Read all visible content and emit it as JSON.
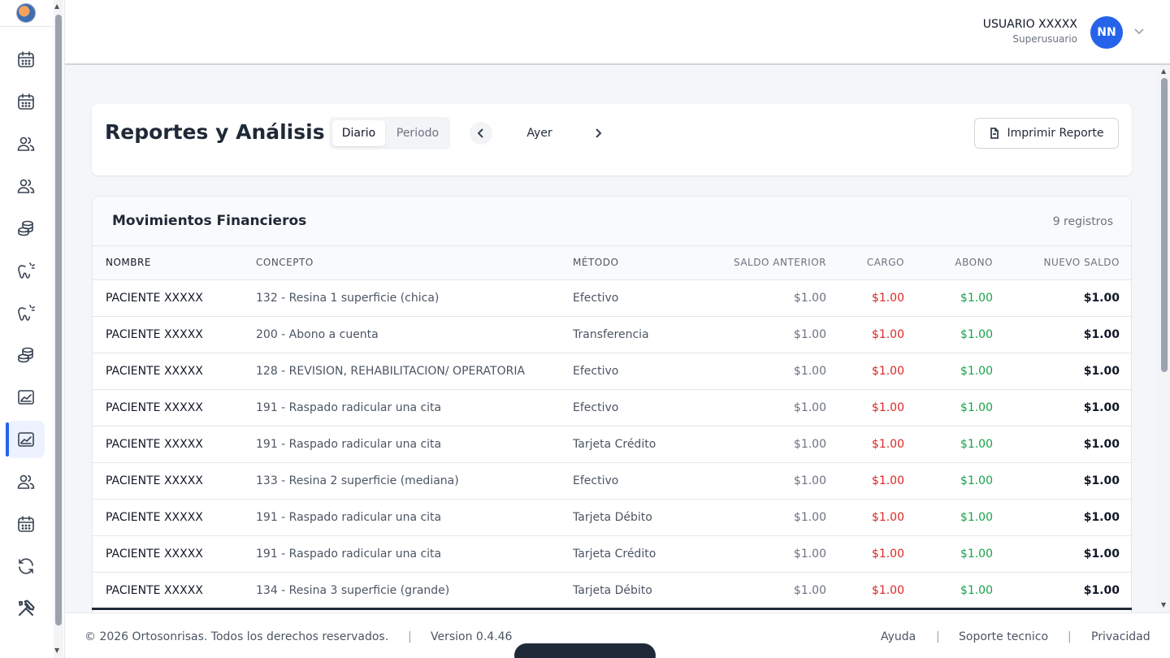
{
  "header": {
    "user_name": "USUARIO XXXXX",
    "user_role": "Superusuario",
    "avatar_initials": "NN"
  },
  "sidebar": {
    "items": [
      {
        "icon": "calendar-icon"
      },
      {
        "icon": "calendar-icon"
      },
      {
        "icon": "users-icon"
      },
      {
        "icon": "users-icon"
      },
      {
        "icon": "coins-icon"
      },
      {
        "icon": "tooth-icon"
      },
      {
        "icon": "tooth-icon"
      },
      {
        "icon": "coins-icon"
      },
      {
        "icon": "chart-icon"
      },
      {
        "icon": "chart-icon",
        "active": true
      },
      {
        "icon": "users-icon"
      },
      {
        "icon": "calendar-icon"
      },
      {
        "icon": "refresh-icon"
      },
      {
        "icon": "tools-icon"
      }
    ]
  },
  "report": {
    "title": "Reportes y Análisis",
    "mode_daily": "Diario",
    "mode_period": "Periodo",
    "date_label": "Ayer",
    "print_label": "Imprimir Reporte"
  },
  "movements": {
    "title": "Movimientos Financieros",
    "count_label": "9 registros",
    "columns": [
      "NOMBRE",
      "CONCEPTO",
      "MÉTODO",
      "SALDO ANTERIOR",
      "CARGO",
      "ABONO",
      "NUEVO SALDO"
    ],
    "rows": [
      {
        "nombre": "PACIENTE XXXXX",
        "concepto": "132 - Resina 1 superficie (chica)",
        "metodo": "Efectivo",
        "saldo": "$1.00",
        "cargo": "$1.00",
        "abono": "$1.00",
        "nuevo": "$1.00"
      },
      {
        "nombre": "PACIENTE XXXXX",
        "concepto": "200 - Abono a cuenta",
        "metodo": "Transferencia",
        "saldo": "$1.00",
        "cargo": "$1.00",
        "abono": "$1.00",
        "nuevo": "$1.00"
      },
      {
        "nombre": "PACIENTE XXXXX",
        "concepto": "128 - REVISION, REHABILITACION/ OPERATORIA",
        "metodo": "Efectivo",
        "saldo": "$1.00",
        "cargo": "$1.00",
        "abono": "$1.00",
        "nuevo": "$1.00"
      },
      {
        "nombre": "PACIENTE XXXXX",
        "concepto": "191 - Raspado radicular una cita",
        "metodo": "Efectivo",
        "saldo": "$1.00",
        "cargo": "$1.00",
        "abono": "$1.00",
        "nuevo": "$1.00"
      },
      {
        "nombre": "PACIENTE XXXXX",
        "concepto": "191 - Raspado radicular una cita",
        "metodo": "Tarjeta Crédito",
        "saldo": "$1.00",
        "cargo": "$1.00",
        "abono": "$1.00",
        "nuevo": "$1.00"
      },
      {
        "nombre": "PACIENTE XXXXX",
        "concepto": "133 - Resina 2 superficie (mediana)",
        "metodo": "Efectivo",
        "saldo": "$1.00",
        "cargo": "$1.00",
        "abono": "$1.00",
        "nuevo": "$1.00"
      },
      {
        "nombre": "PACIENTE XXXXX",
        "concepto": "191 - Raspado radicular una cita",
        "metodo": "Tarjeta Débito",
        "saldo": "$1.00",
        "cargo": "$1.00",
        "abono": "$1.00",
        "nuevo": "$1.00"
      },
      {
        "nombre": "PACIENTE XXXXX",
        "concepto": "191 - Raspado radicular una cita",
        "metodo": "Tarjeta Crédito",
        "saldo": "$1.00",
        "cargo": "$1.00",
        "abono": "$1.00",
        "nuevo": "$1.00"
      },
      {
        "nombre": "PACIENTE XXXXX",
        "concepto": "134 - Resina 3 superficie (grande)",
        "metodo": "Tarjeta Débito",
        "saldo": "$1.00",
        "cargo": "$1.00",
        "abono": "$1.00",
        "nuevo": "$1.00"
      }
    ]
  },
  "footer": {
    "copyright": "© 2026 Ortosonrisas. Todos los derechos reservados.",
    "separator": "|",
    "version": "Version 0.4.46",
    "link_help": "Ayuda",
    "link_support": "Soporte tecnico",
    "link_privacy": "Privacidad"
  },
  "colors": {
    "accent": "#2563eb",
    "cargo": "#dc2626",
    "abono": "#16a34a"
  }
}
